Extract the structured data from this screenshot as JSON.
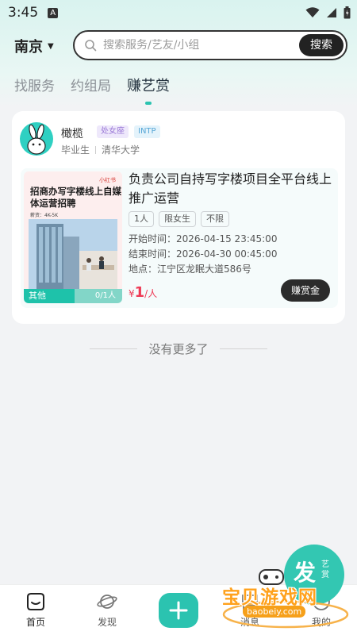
{
  "status": {
    "time": "3:45",
    "notif": "A"
  },
  "header": {
    "city": "南京",
    "search_placeholder": "搜索服务/艺友/小组",
    "search_button": "搜索"
  },
  "tabs": [
    {
      "label": "找服务"
    },
    {
      "label": "约组局"
    },
    {
      "label": "赚艺赏",
      "active": true
    }
  ],
  "post": {
    "user": {
      "name": "橄榄",
      "zodiac": "处女座",
      "mbti": "INTP",
      "status": "毕业生",
      "school": "清华大学"
    },
    "poster": {
      "brand": "小红书",
      "title": "招商办写字楼线上自媒体运营招聘",
      "subtitle": "薪资：4K-5K",
      "category": "其他",
      "count": "0/1人"
    },
    "title": "负责公司自持写字楼项目全平台线上推广运营",
    "tags": [
      "1人",
      "限女生",
      "不限"
    ],
    "start": "开始时间：2026-04-15 23:45:00",
    "end": "结束时间：2026-04-30 00:45:00",
    "location": "地点：江宁区龙眠大道586号",
    "price_symbol": "¥",
    "price_value": "1",
    "price_unit": "/人",
    "action": "赚赏金"
  },
  "no_more": "没有更多了",
  "fab": {
    "main": "发",
    "sub": "艺赏"
  },
  "nav": [
    {
      "label": "首页",
      "active": true
    },
    {
      "label": "发现"
    },
    {
      "label": "消息"
    },
    {
      "label": "我的"
    }
  ],
  "watermark": {
    "text": "宝贝游戏网",
    "url": "baobeiy.com"
  },
  "colors": {
    "accent": "#2bc3b0",
    "price": "#ee3a55",
    "dark": "#222222"
  }
}
